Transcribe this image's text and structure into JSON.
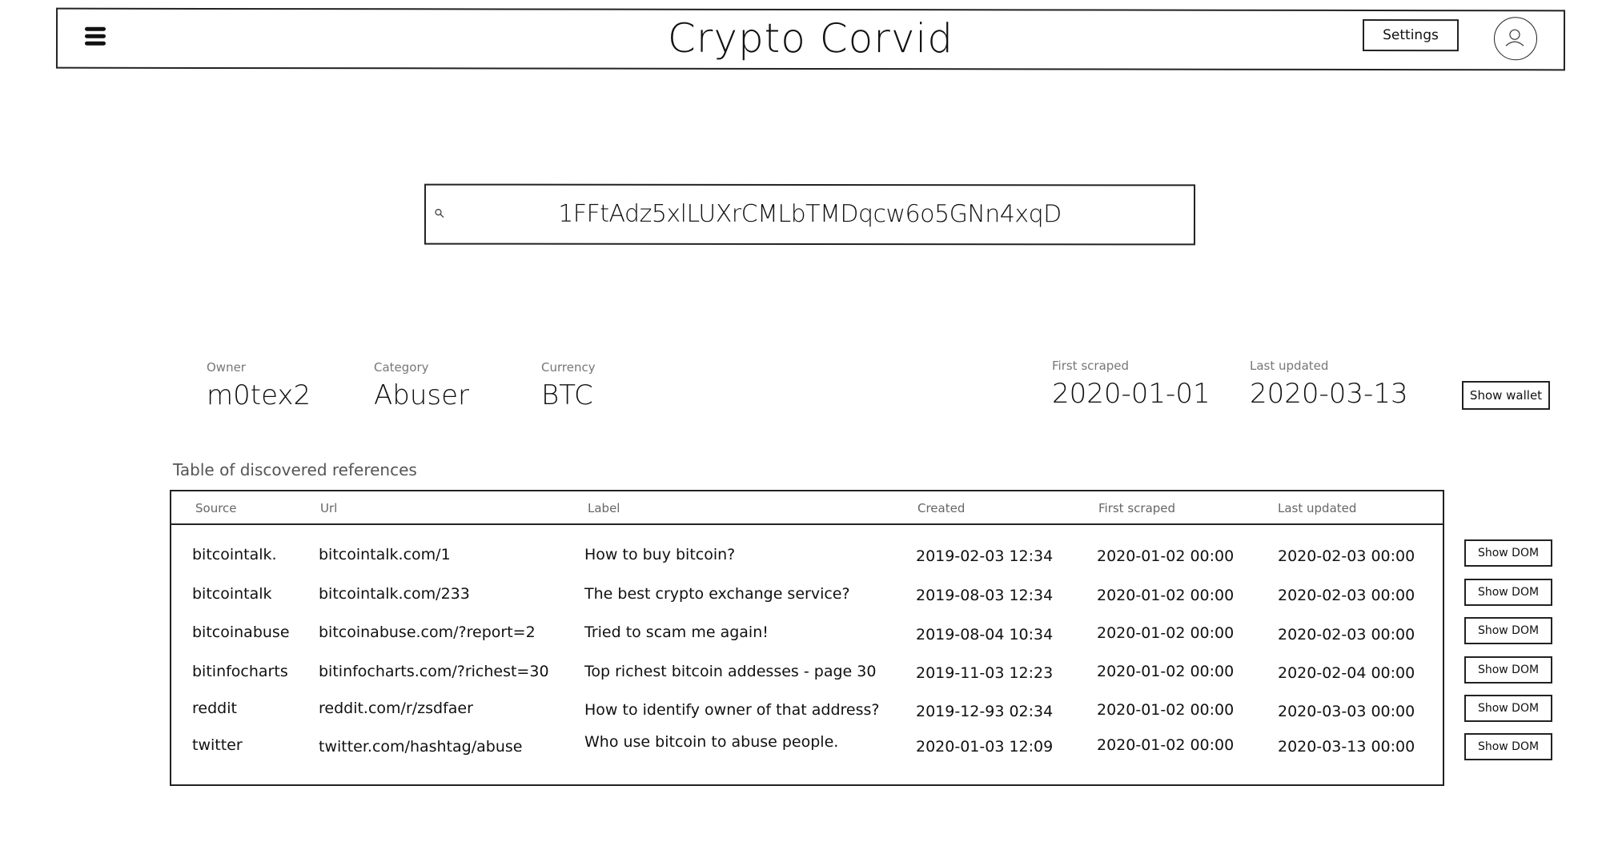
{
  "header": {
    "title": "Crypto Corvid",
    "settings_label": "Settings",
    "menu_icon": "hamburger-icon",
    "avatar_icon": "user-icon"
  },
  "search": {
    "value": "1FFtAdz5xlLUXrCMLbTMDqcw6o5GNn4xqD",
    "icon": "search-icon"
  },
  "wallet": {
    "owner_label": "Owner",
    "owner": "m0tex2",
    "category_label": "Category",
    "category": "Abuser",
    "currency_label": "Currency",
    "currency": "BTC",
    "first_scraped_label": "First scraped",
    "first_scraped": "2020-01-01",
    "last_updated_label": "Last updated",
    "last_updated": "2020-03-13",
    "show_wallet_label": "Show wallet"
  },
  "table": {
    "caption": "Table of discovered references",
    "columns": [
      "Source",
      "Url",
      "Label",
      "Created",
      "First scraped",
      "Last updated"
    ],
    "show_dom_label": "Show DOM",
    "rows": [
      {
        "source": "bitcointalk.",
        "url": "bitcointalk.com/1",
        "label": "How to buy bitcoin?",
        "created": "2019-02-03 12:34",
        "first_scraped": "2020-01-02 00:00",
        "last_updated": "2020-02-03 00:00"
      },
      {
        "source": "bitcointalk",
        "url": "bitcointalk.com/233",
        "label": "The best crypto exchange service?",
        "created": "2019-08-03 12:34",
        "first_scraped": "2020-01-02 00:00",
        "last_updated": "2020-02-03 00:00"
      },
      {
        "source": "bitcoinabuse",
        "url": "bitcoinabuse.com/?report=2",
        "label": "Tried to scam me again!",
        "created": "2019-08-04 10:34",
        "first_scraped": "2020-01-02 00:00",
        "last_updated": "2020-02-03 00:00"
      },
      {
        "source": "bitinfocharts",
        "url": "bitinfocharts.com/?richest=30",
        "label": "Top richest bitcoin addesses - page 30",
        "created": "2019-11-03 12:23",
        "first_scraped": "2020-01-02 00:00",
        "last_updated": "2020-02-04 00:00"
      },
      {
        "source": "reddit",
        "url": "reddit.com/r/zsdfaer",
        "label": "How to identify owner of that address?",
        "created": "2019-12-93 02:34",
        "first_scraped": "2020-01-02 00:00",
        "last_updated": "2020-03-03 00:00"
      },
      {
        "source": "twitter",
        "url": "twitter.com/hashtag/abuse",
        "label": "Who use bitcoin to abuse people.",
        "created": "2020-01-03 12:09",
        "first_scraped": "2020-01-02 00:00",
        "last_updated": "2020-03-13 00:00"
      }
    ]
  }
}
